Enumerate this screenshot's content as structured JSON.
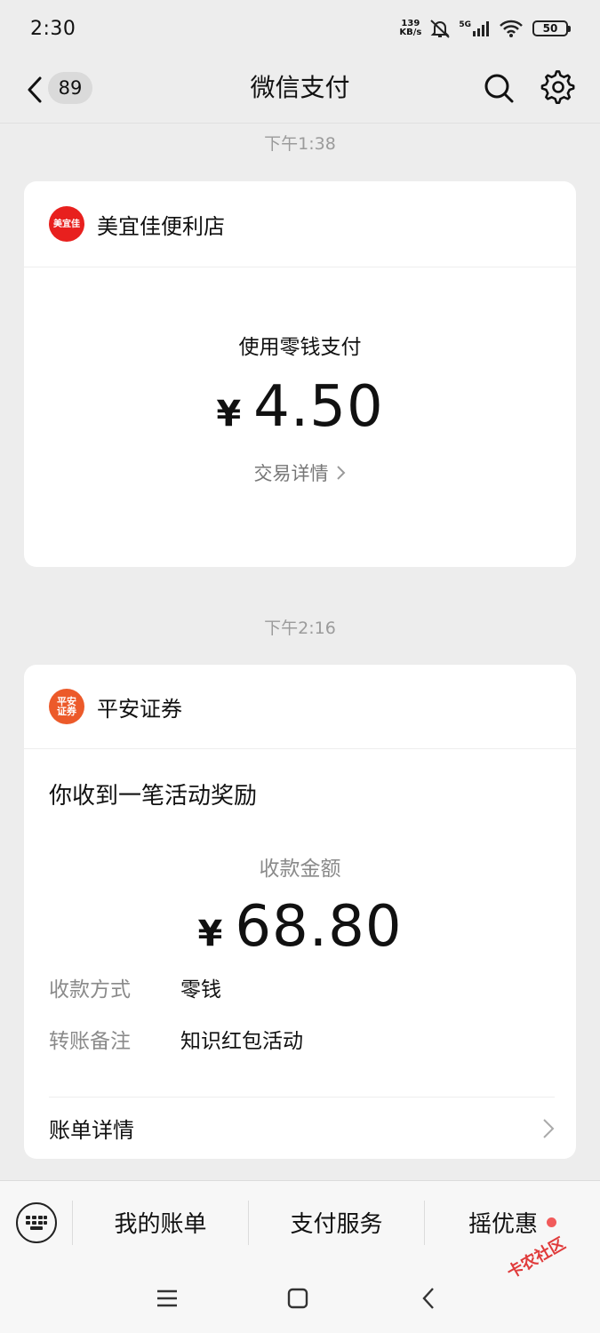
{
  "status_bar": {
    "time": "2:30",
    "net_speed_value": "139",
    "net_speed_unit": "KB/s",
    "network": "5G",
    "battery": "50"
  },
  "nav": {
    "badge_count": "89",
    "title": "微信支付"
  },
  "messages": [
    {
      "timestamp": "下午1:38",
      "merchant": "美宜佳便利店",
      "logo_text": "美宜佳",
      "logo_color": "#e8201e",
      "pay_method": "使用零钱支付",
      "currency": "¥",
      "amount": "4.50",
      "detail_link": "交易详情"
    },
    {
      "timestamp": "下午2:16",
      "merchant": "平安证券",
      "logo_text_line1": "平安",
      "logo_text_line2": "证券",
      "logo_color": "#ec5a2a",
      "title": "你收到一笔活动奖励",
      "receive_label": "收款金额",
      "currency": "¥",
      "amount": "68.80",
      "rows": [
        {
          "key": "收款方式",
          "value": "零钱"
        },
        {
          "key": "转账备注",
          "value": "知识红包活动"
        }
      ],
      "bill_link": "账单详情"
    }
  ],
  "bottom_menu": {
    "items": [
      "我的账单",
      "支付服务",
      "摇优惠"
    ]
  },
  "watermark": "卡农社区"
}
